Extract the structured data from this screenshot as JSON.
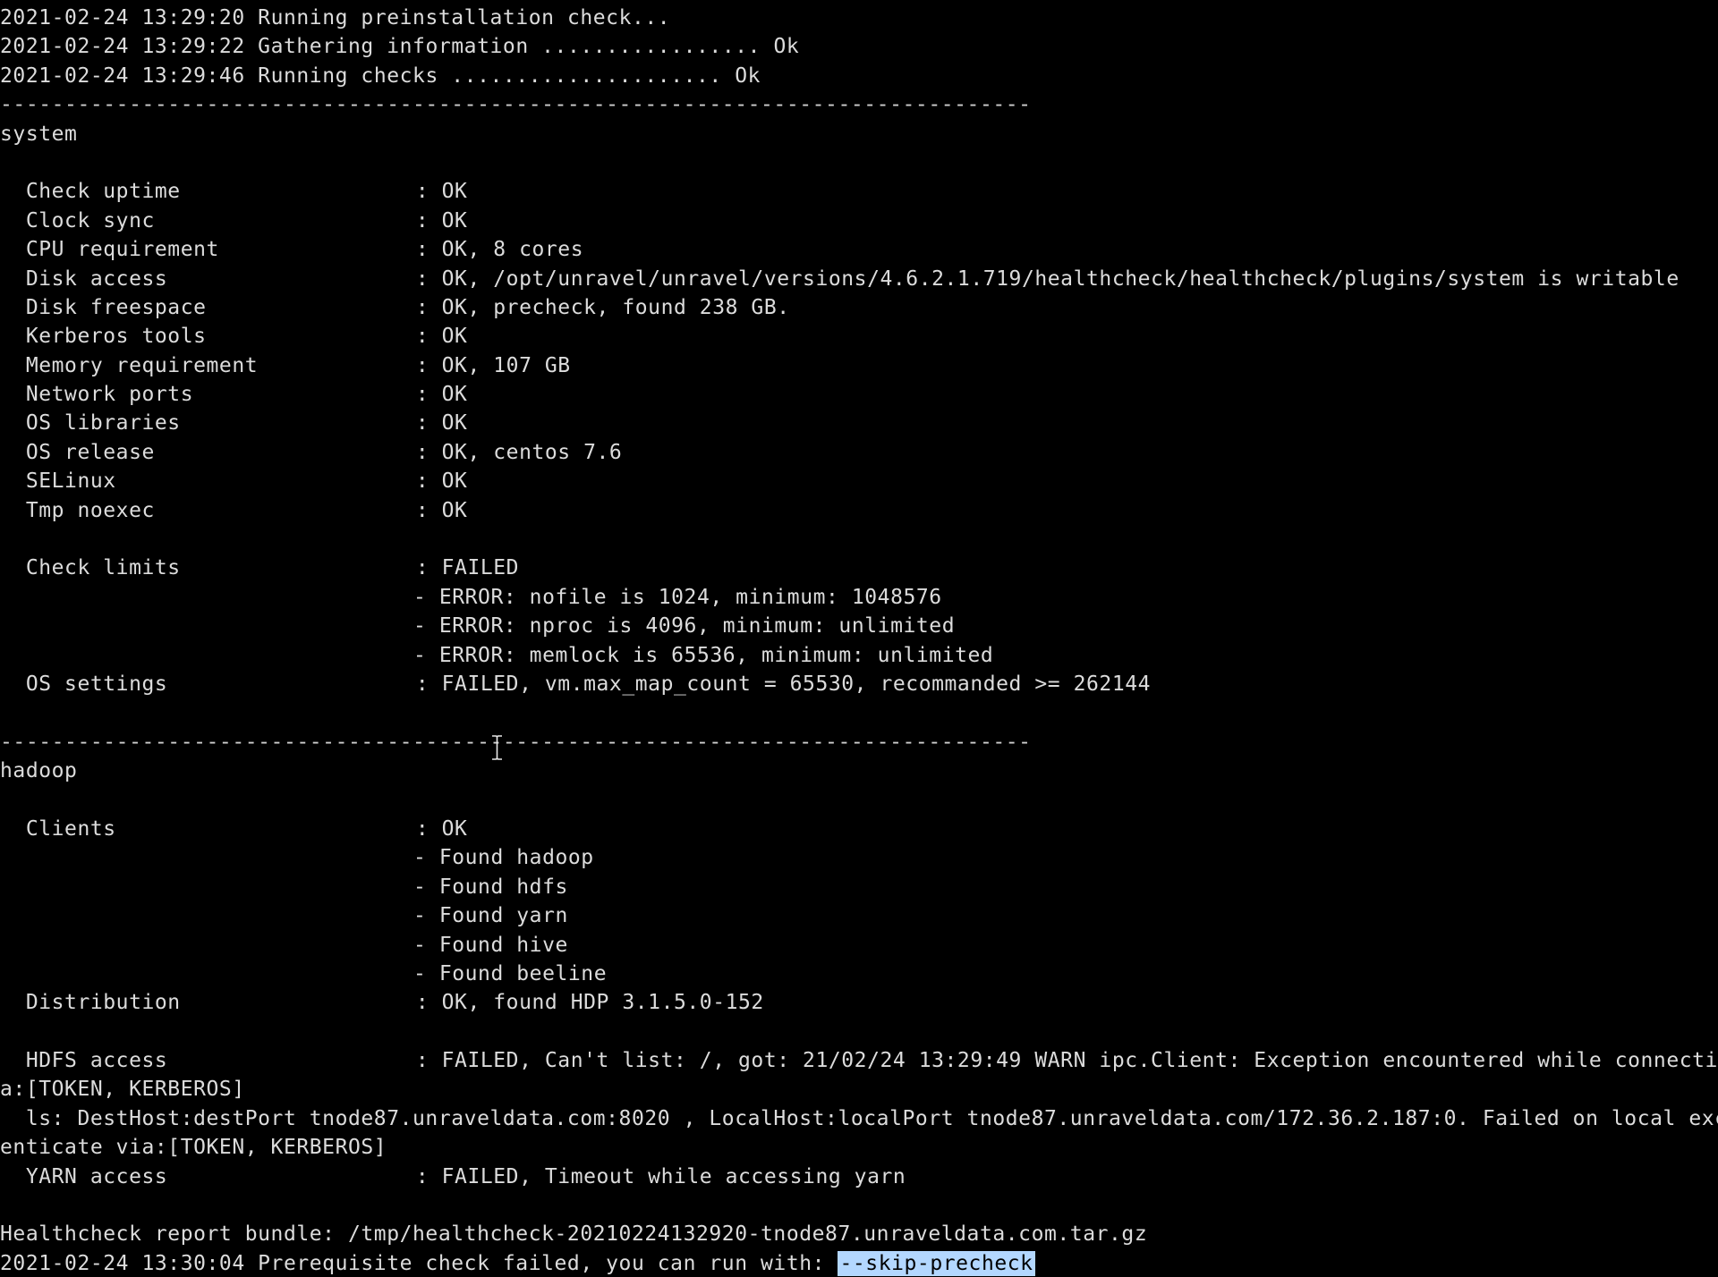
{
  "preamble": [
    {
      "timestamp": "2021-02-24 13:29:20",
      "message": "Running preinstallation check..."
    },
    {
      "timestamp": "2021-02-24 13:29:22",
      "message": "Gathering information ................. Ok"
    },
    {
      "timestamp": "2021-02-24 13:29:46",
      "message": "Running checks ..................... Ok"
    }
  ],
  "separator": "--------------------------------------------------------------------------------",
  "system": {
    "heading": "system",
    "checks": [
      {
        "label": "Check uptime",
        "result": ": OK"
      },
      {
        "label": "Clock sync",
        "result": ": OK"
      },
      {
        "label": "CPU requirement",
        "result": ": OK, 8 cores"
      },
      {
        "label": "Disk access",
        "result": ": OK, /opt/unravel/unravel/versions/4.6.2.1.719/healthcheck/healthcheck/plugins/system is writable"
      },
      {
        "label": "Disk freespace",
        "result": ": OK, precheck, found 238 GB."
      },
      {
        "label": "Kerberos tools",
        "result": ": OK"
      },
      {
        "label": "Memory requirement",
        "result": ": OK, 107 GB"
      },
      {
        "label": "Network ports",
        "result": ": OK"
      },
      {
        "label": "OS libraries",
        "result": ": OK"
      },
      {
        "label": "OS release",
        "result": ": OK, centos 7.6"
      },
      {
        "label": "SELinux",
        "result": ": OK"
      },
      {
        "label": "Tmp noexec",
        "result": ": OK"
      }
    ],
    "limits": {
      "label": "Check limits",
      "result": ": FAILED",
      "errors": [
        "- ERROR: nofile is 1024, minimum: 1048576",
        "- ERROR: nproc is 4096, minimum: unlimited",
        "- ERROR: memlock is 65536, minimum: unlimited"
      ]
    },
    "os_settings": {
      "label": "OS settings",
      "result": ": FAILED, vm.max_map_count = 65530, recommanded >= 262144"
    }
  },
  "hadoop": {
    "heading": "hadoop",
    "clients": {
      "label": "Clients",
      "result": ": OK",
      "found": [
        "- Found hadoop",
        "- Found hdfs",
        "- Found yarn",
        "- Found hive",
        "- Found beeline"
      ]
    },
    "distribution": {
      "label": "Distribution",
      "result": ": OK, found HDP 3.1.5.0-152"
    },
    "hdfs_access": {
      "label": "HDFS access",
      "result": ": FAILED, Can't list: /, got: 21/02/24 13:29:49 WARN ipc.Client: Exception encountered while connecting to th",
      "wrap1": "a:[TOKEN, KERBEROS]",
      "wrap2": "  ls: DestHost:destPort tnode87.unraveldata.com:8020 , LocalHost:localPort tnode87.unraveldata.com/172.36.2.187:0. Failed on local exception:",
      "wrap3": "enticate via:[TOKEN, KERBEROS]"
    },
    "yarn_access": {
      "label": "YARN access",
      "result": ": FAILED, Timeout while accessing yarn"
    }
  },
  "report": "Healthcheck report bundle: /tmp/healthcheck-20210224132920-tnode87.unraveldata.com.tar.gz",
  "final": {
    "prefix": "2021-02-24 13:30:04 Prerequisite check failed, you can run with: ",
    "flag": "--skip-precheck"
  }
}
